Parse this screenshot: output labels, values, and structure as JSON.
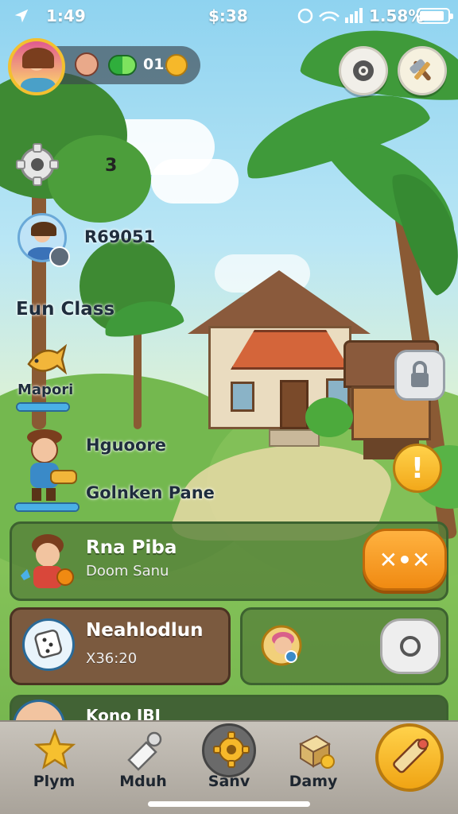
{
  "status_bar": {
    "time_left": "1:49",
    "time_mid": "$:38",
    "battery_text": "1.58%"
  },
  "profile": {
    "currency_text": "01."
  },
  "left_column": {
    "cog_count": "3",
    "player_id": "R69051",
    "class_label": "Eun Class",
    "import_label": "Mapori",
    "import_progress": 1.0,
    "hero_name": "Hguoore",
    "hero_task": "Golnken Pane",
    "hero_progress": 1.0
  },
  "panels": {
    "quest": {
      "title": "Rna  Piba",
      "subtitle": "Doom Sanu"
    },
    "inventory": {
      "title": "Neahlodlun",
      "value": "X36:20"
    },
    "partial": {
      "title": "Kono JBI"
    }
  },
  "bottom_nav": {
    "items": [
      {
        "label": "Plym",
        "icon": "star-icon"
      },
      {
        "label": "Mduh",
        "icon": "shuttlecock-icon"
      },
      {
        "label": "Sanv",
        "icon": "gear-icon"
      },
      {
        "label": "Damy",
        "icon": "box-icon"
      }
    ],
    "cta_icon": "pencil-icon"
  },
  "colors": {
    "accent_orange": "#f08a12",
    "accent_yellow": "#f6b82a",
    "panel_green": "#56803a",
    "panel_brown": "#7b5a3f"
  }
}
